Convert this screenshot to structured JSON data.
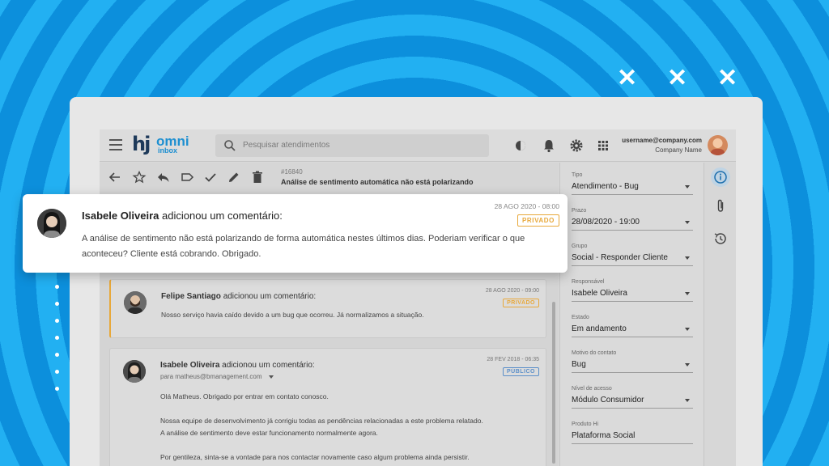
{
  "deco": {
    "marks": [
      "✕",
      "✕",
      "✕"
    ]
  },
  "app": {
    "logo": {
      "mark": "hj",
      "name": "omni",
      "sub": "inbox"
    },
    "search": {
      "placeholder": "Pesquisar atendimentos"
    },
    "user": {
      "email": "username@company.com",
      "company": "Company Name"
    }
  },
  "ticket": {
    "number": "#16840",
    "subject": "Análise de sentimento automática não está polarizando"
  },
  "highlight": {
    "author": "Isabele Oliveira",
    "action": "adicionou um comentário:",
    "date": "28 AGO 2020 - 08:00",
    "badge": "PRIVADO",
    "text": "A análise de sentimento não está polarizando de forma automática nestes últimos dias. Poderiam verificar o que aconteceu? Cliente está cobrando. Obrigado."
  },
  "comments": [
    {
      "author": "Felipe Santiago",
      "action": "adicionou um comentário:",
      "date": "28 AGO 2020 - 09:00",
      "badge": "PRIVADO",
      "text": "Nosso serviço havia caído devido a um bug que ocorreu. Já normalizamos a situação."
    },
    {
      "author": "Isabele Oliveira",
      "action": "adicionou um comentário:",
      "date": "28 FEV 2018 - 06:35",
      "badge": "PÚBLICO",
      "to": "para matheus@bmanagement.com",
      "lines": [
        "Olá Matheus. Obrigado por entrar em contato conosco.",
        "Nossa equipe de desenvolvimento já corrigiu todas as pendências relacionadas a este problema relatado.",
        "A análise de sentimento deve estar funcionamento normalmente agora.",
        "Por gentileza, sinta-se a vontade para nos contactar novamente caso algum problema ainda persistir."
      ]
    }
  ],
  "details": [
    {
      "label": "Tipo",
      "value": "Atendimento - Bug"
    },
    {
      "label": "Prazo",
      "value": "28/08/2020 - 19:00"
    },
    {
      "label": "Grupo",
      "value": "Social - Responder Cliente"
    },
    {
      "label": "Responsável",
      "value": "Isabele Oliveira"
    },
    {
      "label": "Estado",
      "value": "Em andamento"
    },
    {
      "label": "Motivo do contato",
      "value": "Bug"
    },
    {
      "label": "Nível de acesso",
      "value": "Módulo Consumidor"
    },
    {
      "label": "Produto Hi",
      "value": "Plataforma Social"
    }
  ],
  "colors": {
    "accent": "#1d8fd1",
    "private": "#e8a83a",
    "public": "#5b8fc9",
    "background": "#1fa3ea"
  }
}
